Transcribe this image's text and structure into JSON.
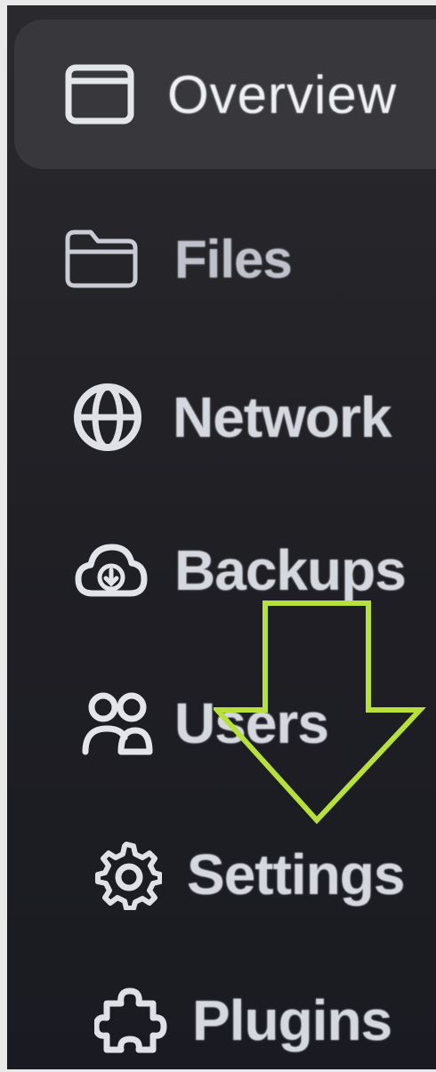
{
  "sidebar": {
    "items": [
      {
        "label": "Overview",
        "icon": "window-icon",
        "active": true
      },
      {
        "label": "Files",
        "icon": "folder-icon",
        "active": false
      },
      {
        "label": "Network",
        "icon": "globe-icon",
        "active": false
      },
      {
        "label": "Backups",
        "icon": "cloud-download-icon",
        "active": false
      },
      {
        "label": "Users",
        "icon": "users-icon",
        "active": false
      },
      {
        "label": "Settings",
        "icon": "gear-icon",
        "active": false
      },
      {
        "label": "Plugins",
        "icon": "puzzle-icon",
        "active": false
      }
    ]
  },
  "annotation": {
    "icon": "down-arrow-icon",
    "color": "#b8e03a"
  },
  "colors": {
    "sidebar_background": "#1f1f24",
    "active_item_background": "#38383c",
    "text": "#d6d8df"
  }
}
